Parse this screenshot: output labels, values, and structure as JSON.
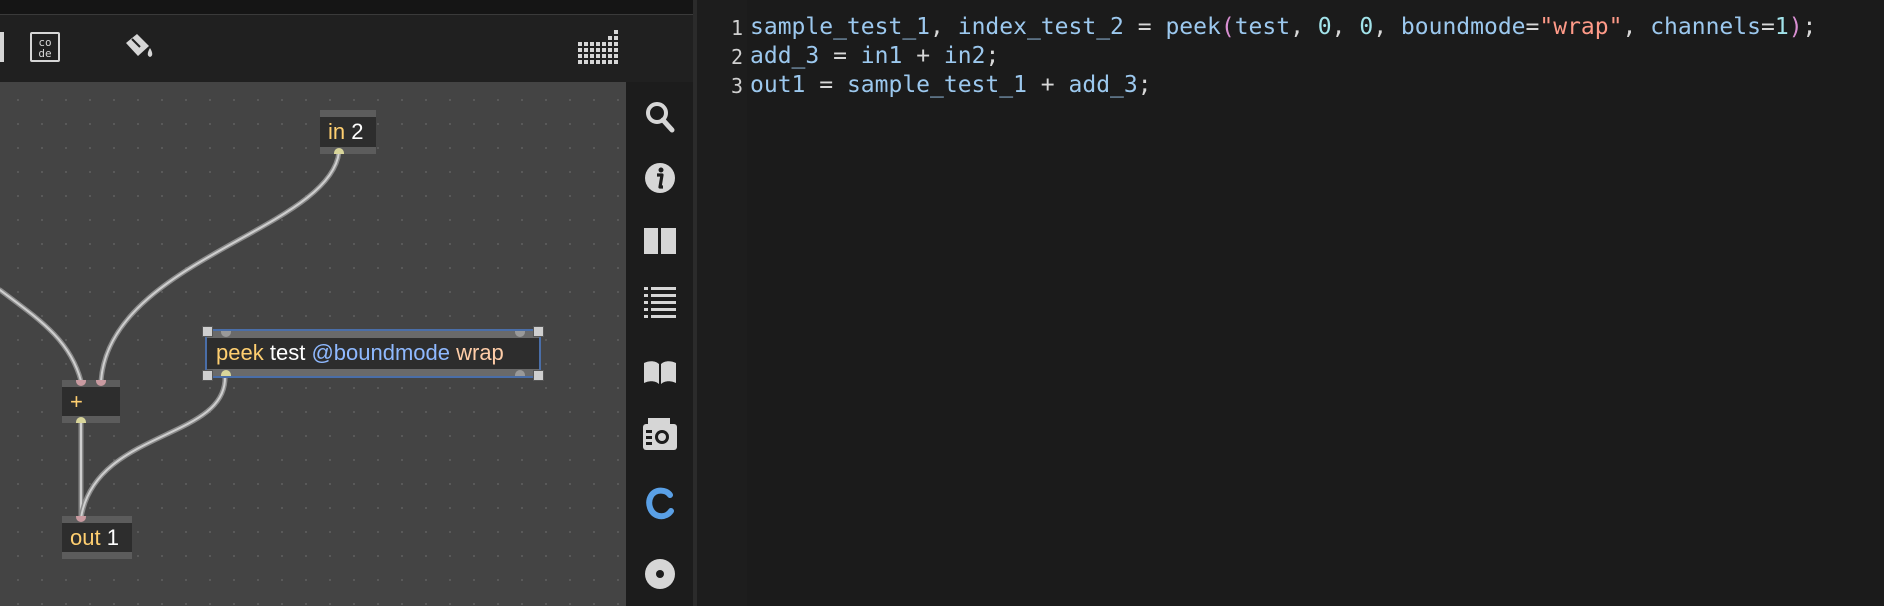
{
  "toolbar": {
    "code_icon_text": "co\nde",
    "code_icon_top": "co",
    "code_icon_bottom": "de"
  },
  "patcher": {
    "objects": {
      "in2": {
        "kw": "in",
        "arg": "2"
      },
      "plus": {
        "kw": "+"
      },
      "out1": {
        "kw": "out",
        "arg": "1"
      },
      "peek": {
        "kw": "peek",
        "arg": "test",
        "attr": "@boundmode",
        "val": "wrap"
      }
    }
  },
  "sidebar": {
    "icons": [
      "search-icon",
      "info-icon",
      "split-view-icon",
      "list-icon",
      "reference-book-icon",
      "snapshot-camera-icon",
      "code-c-icon",
      "circle-dot-icon"
    ]
  },
  "editor": {
    "line_numbers": [
      "1",
      "2",
      "3"
    ],
    "lines": {
      "l1": {
        "a": "sample_test_1",
        "b": ", ",
        "c": "index_test_2",
        "d": " = ",
        "e": "peek",
        "f": "(",
        "g": "test",
        "h": ", ",
        "i": "0",
        "j": ", ",
        "k": "0",
        "l": ", ",
        "m": "boundmode",
        "n": "=",
        "o": "\"wrap\"",
        "p": ", ",
        "q": "channels",
        "r": "=",
        "s": "1",
        "t": ")",
        "u": ";"
      },
      "l2": {
        "a": "add_3",
        "b": " = ",
        "c": "in1",
        "d": " + ",
        "e": "in2",
        "f": ";"
      },
      "l3": {
        "a": "out1",
        "b": " = ",
        "c": "sample_test_1",
        "d": " + ",
        "e": "add_3",
        "f": ";"
      }
    }
  },
  "colors": {
    "canvas": "#444444",
    "accent_blue": "#5aa0e6",
    "selection_outline": "#4a6ea8"
  }
}
